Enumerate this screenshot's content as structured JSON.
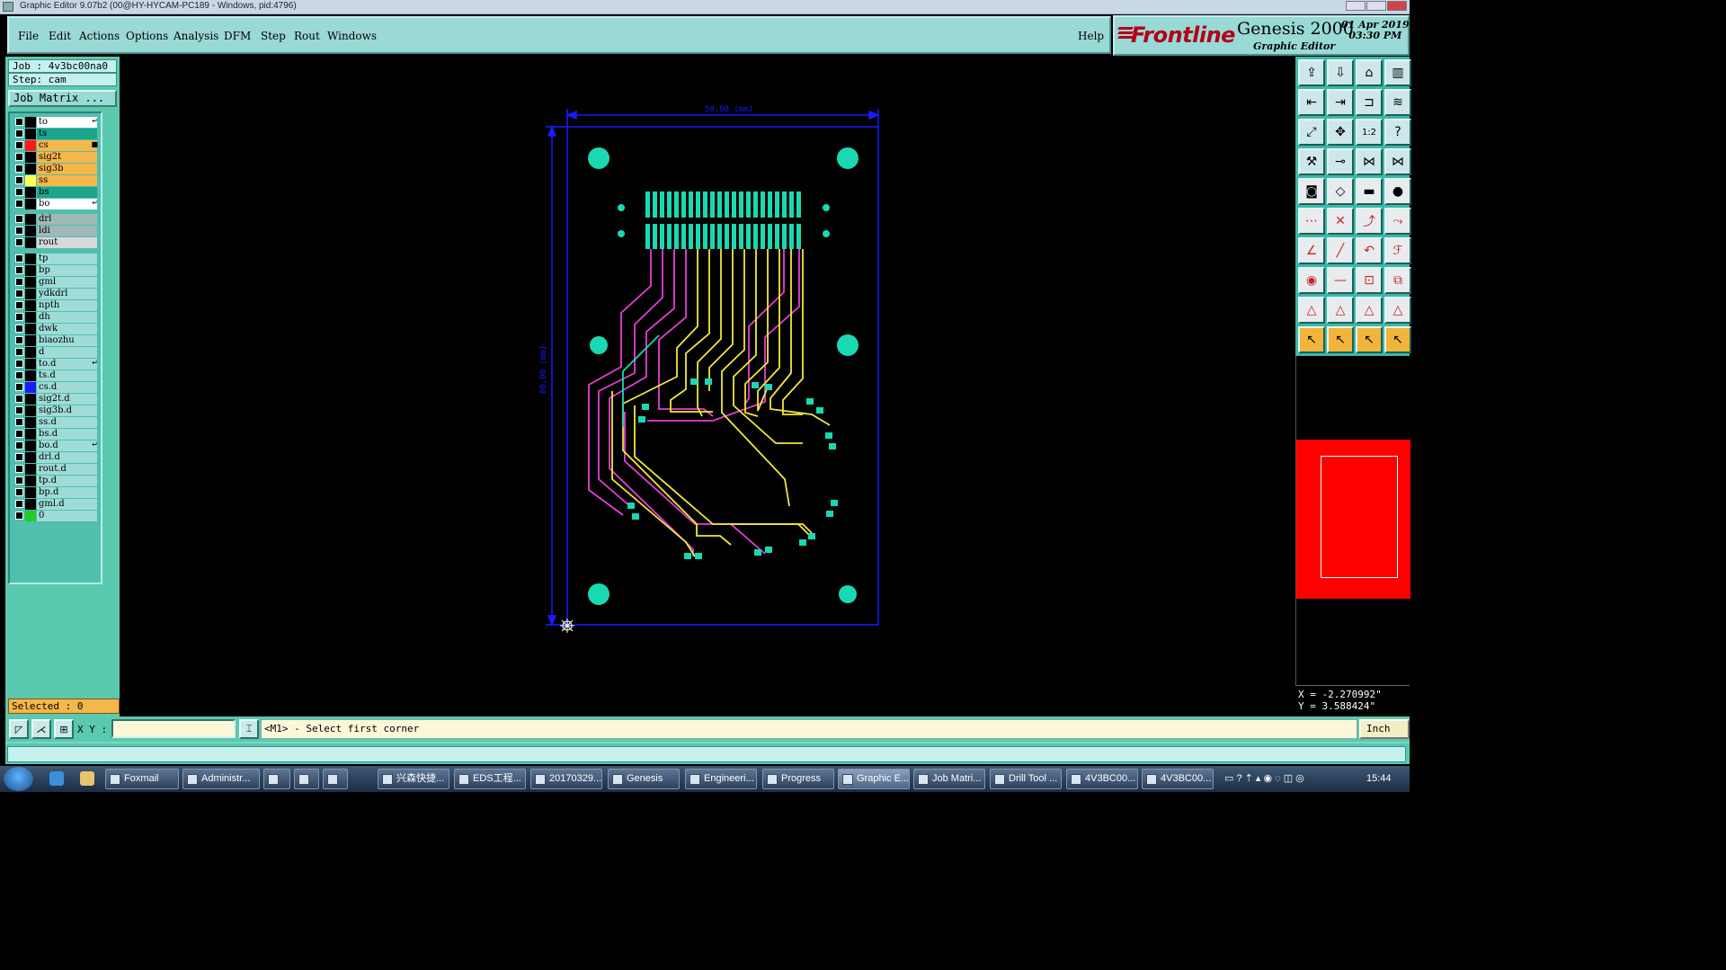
{
  "window": {
    "title": "Graphic Editor 9.07b2 (00@HY-HYCAM-PC189 - Windows, pid:4796)"
  },
  "menu": {
    "items": [
      "File",
      "Edit",
      "Actions",
      "Options",
      "Analysis",
      "DFM",
      "Step",
      "Rout",
      "Windows"
    ],
    "help": "Help"
  },
  "logo": {
    "brand": "Frontline",
    "product": "Genesis 2000",
    "subtitle": "Graphic Editor",
    "date": "01 Apr 2019",
    "time": "03:30 PM"
  },
  "job": {
    "job_label": "Job : 4v3bc00na0",
    "step_label": "Step: cam",
    "matrix_button": "Job Matrix ..."
  },
  "layers_group1": [
    {
      "name": "to",
      "color": "#ffffff",
      "swatch": "#000000",
      "marker": "arrow"
    },
    {
      "name": "ts",
      "color": "#1aa58c",
      "swatch": "#000000",
      "marker": ""
    },
    {
      "name": "cs",
      "color": "#f5b64a",
      "swatch": "#ff1a1a",
      "marker": "dot",
      "active": true
    },
    {
      "name": "sig2t",
      "color": "#f5b64a",
      "swatch": "#000000",
      "marker": ""
    },
    {
      "name": "sig3b",
      "color": "#f5b64a",
      "swatch": "#000000",
      "marker": ""
    },
    {
      "name": "ss",
      "color": "#f5b64a",
      "swatch": "#ffff55",
      "marker": ""
    },
    {
      "name": "bs",
      "color": "#1aa58c",
      "swatch": "#000000",
      "marker": ""
    },
    {
      "name": "bo",
      "color": "#ffffff",
      "swatch": "#000000",
      "marker": "arrow"
    }
  ],
  "layers_group2": [
    {
      "name": "drl",
      "color": "#9fb8b8",
      "swatch": "#000000",
      "marker": ""
    },
    {
      "name": "ldi",
      "color": "#9fb8b8",
      "swatch": "#000000",
      "marker": ""
    },
    {
      "name": "rout",
      "color": "#d8d8d8",
      "swatch": "#000000",
      "marker": ""
    }
  ],
  "layers_group3": [
    {
      "name": "tp",
      "color": "#9fdcd7",
      "swatch": "#000000",
      "marker": ""
    },
    {
      "name": "bp",
      "color": "#9fdcd7",
      "swatch": "#000000",
      "marker": ""
    },
    {
      "name": "gml",
      "color": "#9fdcd7",
      "swatch": "#000000",
      "marker": ""
    },
    {
      "name": "ydkdrl",
      "color": "#9fdcd7",
      "swatch": "#000000",
      "marker": ""
    },
    {
      "name": "npth",
      "color": "#9fdcd7",
      "swatch": "#000000",
      "marker": ""
    },
    {
      "name": "dh",
      "color": "#9fdcd7",
      "swatch": "#000000",
      "marker": ""
    },
    {
      "name": "dwk",
      "color": "#9fdcd7",
      "swatch": "#000000",
      "marker": ""
    },
    {
      "name": "biaozhu",
      "color": "#9fdcd7",
      "swatch": "#000000",
      "marker": ""
    },
    {
      "name": "d",
      "color": "#9fdcd7",
      "swatch": "#000000",
      "marker": ""
    },
    {
      "name": "to.d",
      "color": "#9fdcd7",
      "swatch": "#000000",
      "marker": "arrow"
    },
    {
      "name": "ts.d",
      "color": "#9fdcd7",
      "swatch": "#000000",
      "marker": ""
    },
    {
      "name": "cs.d",
      "color": "#9fdcd7",
      "swatch": "#1a1aff",
      "marker": ""
    },
    {
      "name": "sig2t.d",
      "color": "#9fdcd7",
      "swatch": "#000000",
      "marker": ""
    },
    {
      "name": "sig3b.d",
      "color": "#9fdcd7",
      "swatch": "#000000",
      "marker": ""
    },
    {
      "name": "ss.d",
      "color": "#9fdcd7",
      "swatch": "#000000",
      "marker": ""
    },
    {
      "name": "bs.d",
      "color": "#9fdcd7",
      "swatch": "#000000",
      "marker": ""
    },
    {
      "name": "bo.d",
      "color": "#9fdcd7",
      "swatch": "#000000",
      "marker": "arrow"
    },
    {
      "name": "drl.d",
      "color": "#9fdcd7",
      "swatch": "#000000",
      "marker": ""
    },
    {
      "name": "rout.d",
      "color": "#9fdcd7",
      "swatch": "#000000",
      "marker": ""
    },
    {
      "name": "tp.d",
      "color": "#9fdcd7",
      "swatch": "#000000",
      "marker": ""
    },
    {
      "name": "bp.d",
      "color": "#9fdcd7",
      "swatch": "#000000",
      "marker": ""
    },
    {
      "name": "gml.d",
      "color": "#9fdcd7",
      "swatch": "#000000",
      "marker": ""
    },
    {
      "name": "0",
      "color": "#9fdcd7",
      "swatch": "#22cc22",
      "marker": ""
    }
  ],
  "selected": "Selected : 0",
  "board": {
    "width_label": "50.00 (mm)",
    "height_label": "80.00 (mm)"
  },
  "coords": {
    "x": "X = -2.270992\"",
    "y": "Y = 3.588424\""
  },
  "status": {
    "xy_label": "X Y :",
    "xy_value": "",
    "message": "<M1> - Select first corner",
    "unit": "Inch"
  },
  "taskbar": {
    "items": [
      "Foxmail",
      "Administr...",
      "",
      "",
      "",
      "兴森快捷...",
      "EDS工程...",
      "20170329...",
      "Genesis",
      "Engineeri...",
      "Progress",
      "Graphic E...",
      "Job Matri...",
      "Drill Tool ...",
      "4V3BC00...",
      "4V3BC00..."
    ],
    "clock": "15:44"
  },
  "toolbar_icons": [
    "open-icon",
    "save-icon",
    "home-icon",
    "layout-icon",
    "import-icon",
    "export-icon",
    "snap-icon",
    "stretch-icon",
    "zoom-fit-icon",
    "pan-icon",
    "scale-icon",
    "help-icon",
    "tools-icon",
    "probe-icon",
    "net-icon",
    "net2-icon",
    "camera-icon",
    "rotate-icon",
    "ruler-icon",
    "pad-icon",
    "connect-icon",
    "delete-icon",
    "move-icon",
    "line-icon",
    "arc-icon",
    "arc2-icon",
    "curve-icon",
    "text-icon",
    "pad-add-icon",
    "cut-icon",
    "resize-icon",
    "copy-icon",
    "triangle-icon",
    "triangle2-icon",
    "triangle3-icon",
    "triangle4-icon",
    "pointer-icon",
    "pointer2-icon",
    "pointer3-icon",
    "pointer4-icon"
  ]
}
